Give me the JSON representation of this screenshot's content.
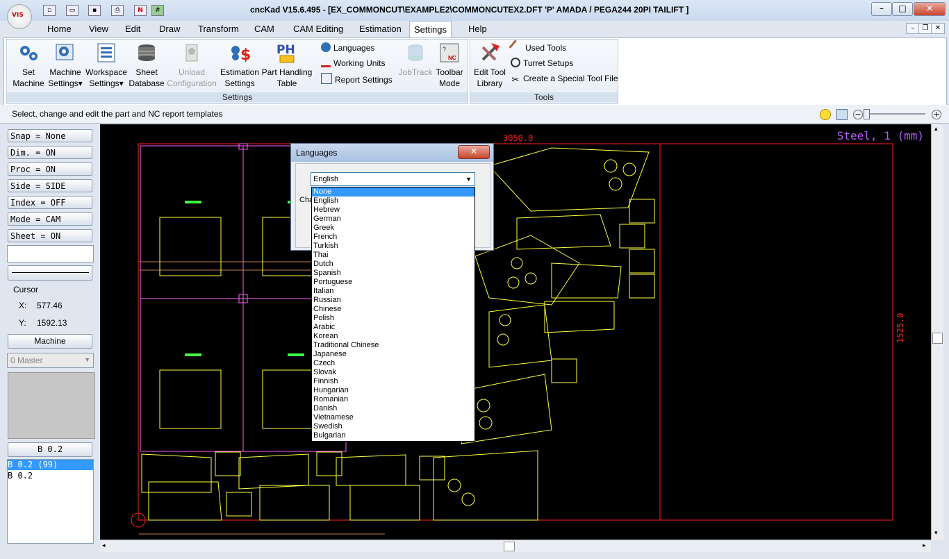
{
  "window": {
    "title": "cncKad V15.6.495 - [EX_COMMONCUT\\EXAMPLE2\\COMMONCUTEX2.DFT  'P'  AMADA / PEGA244   20PI    TAILIFT ]",
    "logo_text": "VIS",
    "minimize": "–",
    "maximize": "□",
    "close": "✕"
  },
  "quick_access": [
    "new-icon",
    "open-icon",
    "save-icon",
    "print-icon",
    "nc-icon",
    "grid-icon"
  ],
  "menu": {
    "tabs": [
      "Home",
      "View",
      "Edit",
      "Draw",
      "Transform",
      "CAM",
      "CAM Editing",
      "Estimation",
      "Settings",
      "Help"
    ],
    "active": "Settings",
    "mdi_min": "–",
    "mdi_restore": "❐",
    "mdi_close": "✕"
  },
  "ribbon": {
    "settings_group": {
      "label": "Settings",
      "buttons": [
        {
          "l1": "Set",
          "l2": "Machine",
          "icon": "gears-icon"
        },
        {
          "l1": "Machine",
          "l2": "Settings▾",
          "icon": "machine-settings-icon"
        },
        {
          "l1": "Workspace",
          "l2": "Settings▾",
          "icon": "workspace-icon"
        },
        {
          "l1": "Sheet",
          "l2": "Database",
          "icon": "sheet-stack-icon"
        },
        {
          "l1": "Unload",
          "l2": "Configuration",
          "icon": "unload-icon"
        },
        {
          "l1": "Estimation",
          "l2": "Settings",
          "icon": "dollar-gears-icon"
        },
        {
          "l1": "Part Handling",
          "l2": "Table",
          "icon": "ph-icon"
        }
      ],
      "small": [
        "Languages",
        "Working Units",
        "Report Settings"
      ],
      "extra": [
        {
          "l1": "JobTrack",
          "l2": "",
          "icon": "jobtrack-icon"
        },
        {
          "l1": "Toolbar",
          "l2": "Mode",
          "icon": "toolbar-mode-icon"
        }
      ]
    },
    "tools_group": {
      "label": "Tools",
      "big": {
        "l1": "Edit Tool",
        "l2": "Library"
      },
      "small": [
        "Used Tools",
        "Turret Setups",
        "Create a Special Tool File"
      ]
    }
  },
  "status": {
    "text": "Select, change and edit the part and NC report templates"
  },
  "left_panel": {
    "toggles": [
      "Snap = None",
      "Dim. = ON",
      "Proc = ON",
      "Side = SIDE",
      "Index = OFF",
      "Mode = CAM",
      "Sheet = ON"
    ],
    "cursor_label": "Cursor",
    "x_label": "X:",
    "x_value": "577.46",
    "y_label": "Y:",
    "y_value": "1592.13",
    "machine_button": "Machine",
    "master_select": "0 Master",
    "b_button": "B 0.2",
    "list_items": [
      "B 0.2  (99)",
      "B 0.2"
    ]
  },
  "canvas": {
    "material_label": "Steel, 1 (mm)",
    "width_dim": "3050.0",
    "height_dim": "1525.0",
    "colors": {
      "background": "#000000",
      "sheet": "#ff2020",
      "parts": "#ffff40",
      "grid": "#ff60ff",
      "dims": "#ff2020",
      "label": "#b060ff"
    }
  },
  "dialog": {
    "title": "Languages",
    "close": "✕",
    "selected": "English",
    "change_label_partial": "Cha",
    "options": [
      "None",
      "English",
      "Hebrew",
      "German",
      "Greek",
      "French",
      "Turkish",
      "Thai",
      "Dutch",
      "Spanish",
      "Portuguese",
      "Italian",
      "Russian",
      "Chinese",
      "Polish",
      "Arabic",
      "Korean",
      "Traditional Chinese",
      "Japanese",
      "Czech",
      "Slovak",
      "Finnish",
      "Hungarian",
      "Romanian",
      "Danish",
      "Vietnamese",
      "Swedish",
      "Bulgarian"
    ],
    "highlighted": "None"
  }
}
